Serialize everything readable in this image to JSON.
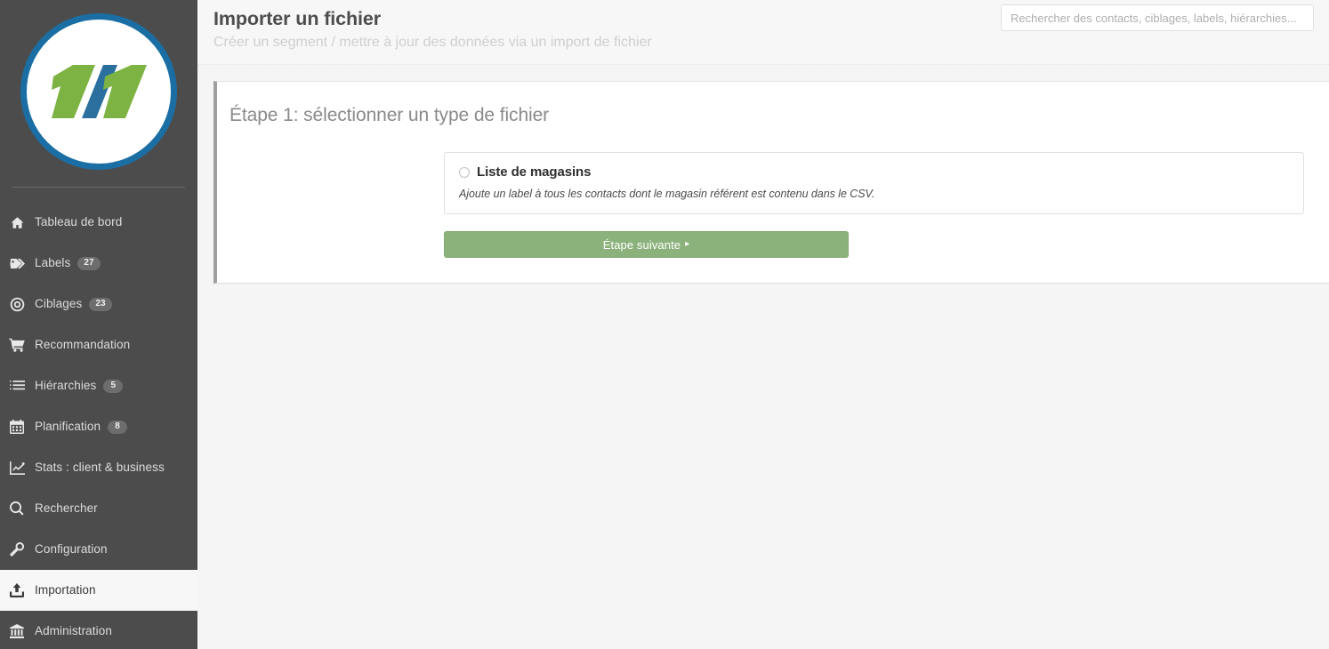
{
  "sidebar": {
    "logo": {
      "alt_text": "1/1",
      "ring_color": "#1b6ea3",
      "stroke_green": "#7cb342",
      "stroke_blue": "#2a6f9e"
    },
    "items": [
      {
        "label": "Tableau de bord",
        "icon": "home-icon",
        "badge": null,
        "active": false
      },
      {
        "label": "Labels",
        "icon": "tag-icon",
        "badge": "27",
        "active": false
      },
      {
        "label": "Ciblages",
        "icon": "target-icon",
        "badge": "23",
        "active": false
      },
      {
        "label": "Recommandation",
        "icon": "cart-icon",
        "badge": null,
        "active": false
      },
      {
        "label": "Hiérarchies",
        "icon": "list-icon",
        "badge": "5",
        "active": false
      },
      {
        "label": "Planification",
        "icon": "calendar-icon",
        "badge": "8",
        "active": false
      },
      {
        "label": "Stats : client & business",
        "icon": "chart-line-icon",
        "badge": null,
        "active": false
      },
      {
        "label": "Rechercher",
        "icon": "search-icon",
        "badge": null,
        "active": false
      },
      {
        "label": "Configuration",
        "icon": "wrench-icon",
        "badge": null,
        "active": false
      },
      {
        "label": "Importation",
        "icon": "upload-icon",
        "badge": null,
        "active": true
      },
      {
        "label": "Administration",
        "icon": "bank-icon",
        "badge": null,
        "active": false
      }
    ]
  },
  "header": {
    "title": "Importer un fichier",
    "subtitle": "Créer un segment / mettre à jour des données via un import de fichier"
  },
  "search": {
    "placeholder": "Rechercher des contacts, ciblages, labels, hiérarchies...",
    "value": ""
  },
  "step": {
    "title": "Étape 1: sélectionner un type de fichier",
    "options": [
      {
        "label": "Liste de magasins",
        "description": "Ajoute un label à tous les contacts dont le magasin référent est contenu dans le CSV.",
        "selected": false
      }
    ],
    "next_button": {
      "label": "Étape suivante",
      "caret": "▸",
      "color": "#8cb27c"
    }
  }
}
